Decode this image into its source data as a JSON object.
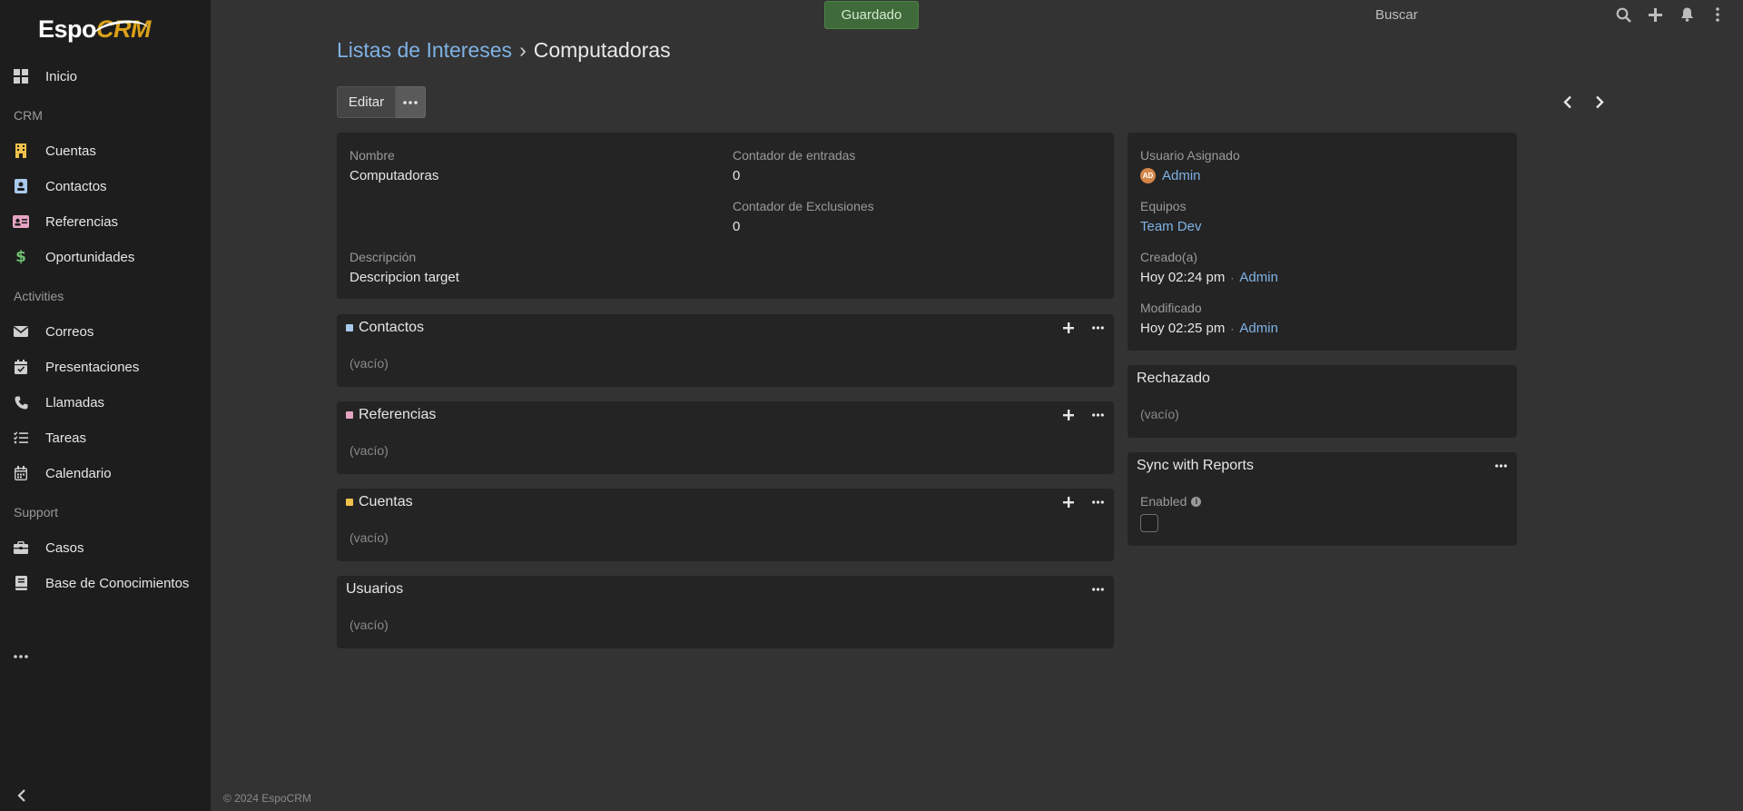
{
  "app": {
    "logo_text_1": "Espo",
    "logo_text_2": "CRM"
  },
  "sidebar": {
    "home": "Inicio",
    "section_crm": "CRM",
    "crm_items": [
      "Cuentas",
      "Contactos",
      "Referencias",
      "Oportunidades"
    ],
    "section_activities": "Activities",
    "activity_items": [
      "Correos",
      "Presentaciones",
      "Llamadas",
      "Tareas",
      "Calendario"
    ],
    "section_support": "Support",
    "support_items": [
      "Casos",
      "Base de Conocimientos"
    ]
  },
  "topbar": {
    "status": "Guardado",
    "search_placeholder": "Buscar"
  },
  "header": {
    "breadcrumb_parent": "Listas de Intereses",
    "breadcrumb_separator": "›",
    "breadcrumb_current": "Computadoras",
    "edit_label": "Editar"
  },
  "overview": {
    "name_label": "Nombre",
    "name_value": "Computadoras",
    "entries_label": "Contador de entradas",
    "entries_value": "0",
    "exclusions_label": "Contador de Exclusiones",
    "exclusions_value": "0",
    "description_label": "Descripción",
    "description_value": "Descripcion target"
  },
  "panels": {
    "contacts_title": "Contactos",
    "leads_title": "Referencias",
    "accounts_title": "Cuentas",
    "users_title": "Usuarios",
    "empty_text": "(vacío)"
  },
  "side": {
    "assigned_label": "Usuario Asignado",
    "assigned_avatar": "AD",
    "assigned_value": "Admin",
    "teams_label": "Equipos",
    "teams_value": "Team Dev",
    "created_label": "Creado(a)",
    "created_time": "Hoy 02:24 pm",
    "created_by": "Admin",
    "modified_label": "Modificado",
    "modified_time": "Hoy 02:25 pm",
    "modified_by": "Admin",
    "rejected_title": "Rechazado",
    "sync_title": "Sync with Reports",
    "enabled_label": "Enabled"
  },
  "footer": {
    "copyright": "© 2024 EspoCRM"
  },
  "colors": {
    "contacts": "#a9c9eb",
    "leads": "#e6a3c3",
    "accounts": "#f0c14b",
    "status_green": "#3f6b3a",
    "link": "#7fb2e5"
  }
}
